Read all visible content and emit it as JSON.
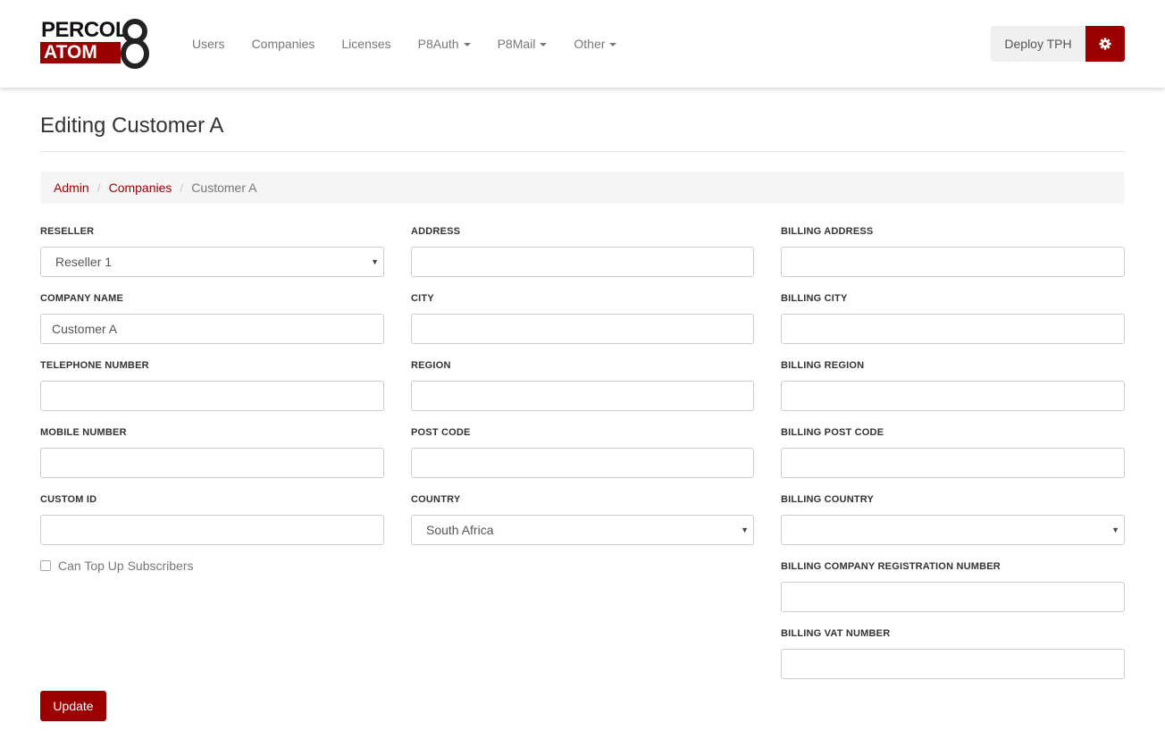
{
  "brand": {
    "line1": "PERCOL",
    "line2": "ATOM",
    "mark": "8"
  },
  "nav": [
    {
      "label": "Users",
      "dropdown": false
    },
    {
      "label": "Companies",
      "dropdown": false
    },
    {
      "label": "Licenses",
      "dropdown": false
    },
    {
      "label": "P8Auth",
      "dropdown": true
    },
    {
      "label": "P8Mail",
      "dropdown": true
    },
    {
      "label": "Other",
      "dropdown": true
    }
  ],
  "header_actions": {
    "deploy_label": "Deploy TPH",
    "settings_icon": "gear-icon"
  },
  "page": {
    "title": "Editing Customer A"
  },
  "breadcrumb": {
    "items": [
      "Admin",
      "Companies"
    ],
    "active": "Customer A"
  },
  "form": {
    "reseller": {
      "label": "Reseller",
      "value": "Reseller 1"
    },
    "company_name": {
      "label": "Company Name",
      "value": "Customer A"
    },
    "telephone_number": {
      "label": "Telephone Number",
      "value": ""
    },
    "mobile_number": {
      "label": "Mobile Number",
      "value": ""
    },
    "custom_id": {
      "label": "Custom ID",
      "value": ""
    },
    "can_top_up": {
      "label": "Can Top Up Subscribers",
      "checked": false
    },
    "address": {
      "label": "Address",
      "value": ""
    },
    "city": {
      "label": "City",
      "value": ""
    },
    "region": {
      "label": "Region",
      "value": ""
    },
    "post_code": {
      "label": "Post Code",
      "value": ""
    },
    "country": {
      "label": "Country",
      "value": "South Africa"
    },
    "billing_address": {
      "label": "Billing Address",
      "value": ""
    },
    "billing_city": {
      "label": "Billing City",
      "value": ""
    },
    "billing_region": {
      "label": "Billing Region",
      "value": ""
    },
    "billing_post_code": {
      "label": "Billing Post Code",
      "value": ""
    },
    "billing_country": {
      "label": "Billing Country",
      "value": ""
    },
    "billing_company_registration_number": {
      "label": "Billing Company Registration Number",
      "value": ""
    },
    "billing_vat_number": {
      "label": "Billing VAT Number",
      "value": ""
    },
    "submit_label": "Update"
  },
  "colors": {
    "brand": "#9b0000",
    "muted_text": "#777777",
    "breadcrumb_bg": "#f5f5f5"
  }
}
